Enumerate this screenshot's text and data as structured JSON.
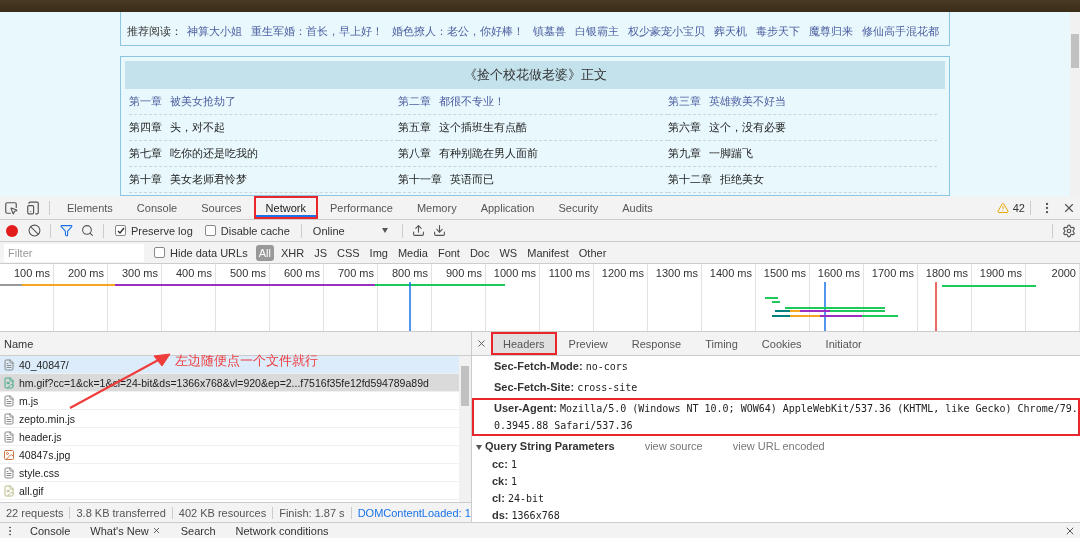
{
  "page": {
    "recommend": {
      "label": "推荐阅读：",
      "links": [
        "神算大小姐",
        "重生军婚：首长，早上好！",
        "婚色撩人：老公，你好棒！",
        "镇墓兽",
        "白银霸主",
        "权少豪宠小宝贝",
        "葬天机",
        "毒步天下",
        "魔尊归来",
        "修仙高手混花都"
      ]
    },
    "chapter_list": {
      "title": "《捡个校花做老婆》正文",
      "chapters": [
        {
          "number": "第一章",
          "name": "被美女抢劫了",
          "visited": true
        },
        {
          "number": "第二章",
          "name": "都很不专业！",
          "visited": true
        },
        {
          "number": "第三章",
          "name": "英雄救美不好当",
          "visited": true
        },
        {
          "number": "第四章",
          "name": "头，对不起",
          "visited": false
        },
        {
          "number": "第五章",
          "name": "这个插班生有点酷",
          "visited": false
        },
        {
          "number": "第六章",
          "name": "这个，没有必要",
          "visited": false
        },
        {
          "number": "第七章",
          "name": "吃你的还是吃我的",
          "visited": false
        },
        {
          "number": "第八章",
          "name": "有种别跪在男人面前",
          "visited": false
        },
        {
          "number": "第九章",
          "name": "一脚踹飞",
          "visited": false
        },
        {
          "number": "第十章",
          "name": "美女老师君怜梦",
          "visited": false
        },
        {
          "number": "第十一章",
          "name": "英语而已",
          "visited": false
        },
        {
          "number": "第十二章",
          "name": "拒绝美女",
          "visited": false
        }
      ]
    }
  },
  "devtools": {
    "tabs": [
      {
        "label": "Elements",
        "selected": false,
        "annotated": false
      },
      {
        "label": "Console",
        "selected": false,
        "annotated": false
      },
      {
        "label": "Sources",
        "selected": false,
        "annotated": false
      },
      {
        "label": "Network",
        "selected": true,
        "annotated": true
      },
      {
        "label": "Performance",
        "selected": false,
        "annotated": false
      },
      {
        "label": "Memory",
        "selected": false,
        "annotated": false
      },
      {
        "label": "Application",
        "selected": false,
        "annotated": false
      },
      {
        "label": "Security",
        "selected": false,
        "annotated": false
      },
      {
        "label": "Audits",
        "selected": false,
        "annotated": false
      }
    ],
    "warnings": "42",
    "toolbar": {
      "recording": true,
      "preserve_log": {
        "label": "Preserve log",
        "checked": true
      },
      "disable_cache": {
        "label": "Disable cache",
        "checked": false
      },
      "throttling": "Online"
    },
    "filter": {
      "placeholder": "Filter",
      "hide_data_urls": {
        "label": "Hide data URLs",
        "checked": false
      },
      "types": [
        {
          "label": "All",
          "selected": true
        },
        {
          "label": "XHR",
          "selected": false
        },
        {
          "label": "JS",
          "selected": false
        },
        {
          "label": "CSS",
          "selected": false
        },
        {
          "label": "Img",
          "selected": false
        },
        {
          "label": "Media",
          "selected": false
        },
        {
          "label": "Font",
          "selected": false
        },
        {
          "label": "Doc",
          "selected": false
        },
        {
          "label": "WS",
          "selected": false
        },
        {
          "label": "Manifest",
          "selected": false
        },
        {
          "label": "Other",
          "selected": false
        }
      ]
    },
    "timeline": {
      "ticks": [
        "100 ms",
        "200 ms",
        "300 ms",
        "400 ms",
        "500 ms",
        "600 ms",
        "700 ms",
        "800 ms",
        "900 ms",
        "1000 ms",
        "1100 ms",
        "1200 ms",
        "1300 ms",
        "1400 ms",
        "1500 ms",
        "1600 ms",
        "1700 ms",
        "1800 ms",
        "1900 ms",
        "2000"
      ]
    },
    "requests": {
      "column": "Name",
      "rows": [
        {
          "name": "40_40847/",
          "kind": "document",
          "selected": false,
          "hovered": true
        },
        {
          "name": "hm.gif?cc=1&ck=1&cl=24-bit&ds=1366x768&vl=920&ep=2...f7516f35fe12fd594789a89d",
          "kind": "image",
          "selected": true,
          "hovered": false
        },
        {
          "name": "m.js",
          "kind": "document",
          "selected": false,
          "hovered": false
        },
        {
          "name": "zepto.min.js",
          "kind": "document",
          "selected": false,
          "hovered": false
        },
        {
          "name": "header.js",
          "kind": "document",
          "selected": false,
          "hovered": false
        },
        {
          "name": "40847s.jpg",
          "kind": "photo",
          "selected": false,
          "hovered": false
        },
        {
          "name": "style.css",
          "kind": "document",
          "selected": false,
          "hovered": false
        },
        {
          "name": "all.gif",
          "kind": "gif",
          "selected": false,
          "hovered": false
        }
      ]
    },
    "detail": {
      "tabs": [
        {
          "label": "Headers",
          "selected": true,
          "annotated": true
        },
        {
          "label": "Preview",
          "selected": false,
          "annotated": false
        },
        {
          "label": "Response",
          "selected": false,
          "annotated": false
        },
        {
          "label": "Timing",
          "selected": false,
          "annotated": false
        },
        {
          "label": "Cookies",
          "selected": false,
          "annotated": false
        },
        {
          "label": "Initiator",
          "selected": false,
          "annotated": false
        }
      ],
      "headers": [
        {
          "name": "Sec-Fetch-Mode:",
          "value": "no-cors",
          "annotated": false
        },
        {
          "name": "Sec-Fetch-Site:",
          "value": "cross-site",
          "annotated": false
        },
        {
          "name": "User-Agent:",
          "value": "Mozilla/5.0 (Windows NT 10.0; WOW64) AppleWebKit/537.36 (KHTML, like Gecko) Chrome/79.0.3945.88 Safari/537.36",
          "annotated": true
        }
      ],
      "section": {
        "title": "Query String Parameters",
        "expanded": true,
        "links": [
          "view source",
          "view URL encoded"
        ]
      },
      "params": [
        {
          "name": "cc:",
          "value": "1"
        },
        {
          "name": "ck:",
          "value": "1"
        },
        {
          "name": "cl:",
          "value": "24-bit"
        },
        {
          "name": "ds:",
          "value": "1366x768"
        }
      ]
    },
    "summary": [
      {
        "text": "22 requests",
        "kind": "plain"
      },
      {
        "text": "3.8 KB transferred",
        "kind": "plain"
      },
      {
        "text": "402 KB resources",
        "kind": "plain"
      },
      {
        "text": "Finish: 1.87 s",
        "kind": "plain"
      },
      {
        "text": "DOMContentLoaded: 1",
        "kind": "event"
      }
    ],
    "drawer_tabs": [
      {
        "label": "Console",
        "closable": false
      },
      {
        "label": "What's New",
        "closable": true
      },
      {
        "label": "Search",
        "closable": false
      },
      {
        "label": "Network conditions",
        "closable": false
      }
    ]
  },
  "annotation": {
    "note": "左边随便点一个文件就行"
  }
}
